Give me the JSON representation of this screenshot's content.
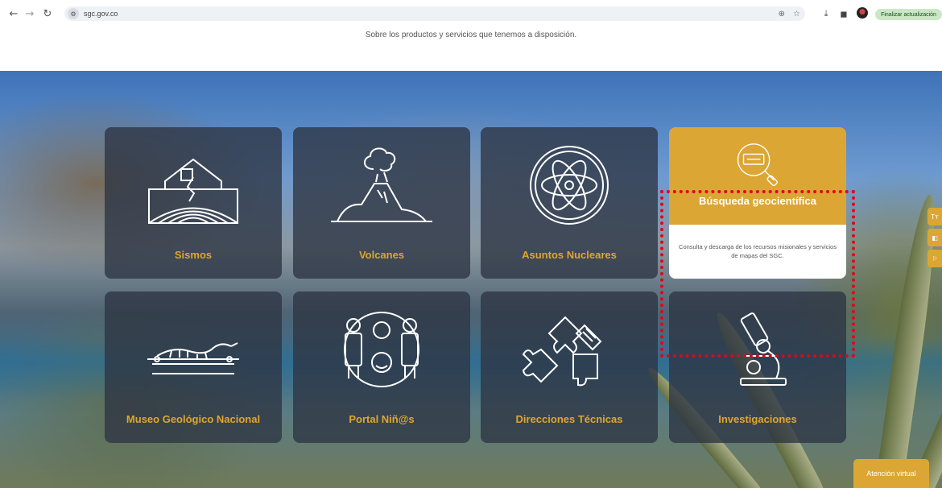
{
  "browser": {
    "back_icon": "arrow-left-icon",
    "forward_icon": "arrow-right-icon",
    "reload_icon": "reload-icon",
    "url": "sgc.gov.co",
    "update_label": "Finalizar actualización"
  },
  "page": {
    "subtitle": "Sobre los productos y servicios que tenemos a disposición."
  },
  "cards": [
    {
      "label": "Sismos",
      "icon": "earthquake-house-icon"
    },
    {
      "label": "Volcanes",
      "icon": "volcano-icon"
    },
    {
      "label": "Asuntos Nucleares",
      "icon": "atom-icon"
    },
    {
      "label": "Búsqueda geocientífica",
      "icon": "magnifier-icon",
      "description": "Consulta y descarga de los recursos misionales y servicios de mapas del SGC."
    },
    {
      "label": "Museo Geológico Nacional",
      "icon": "dinosaur-icon"
    },
    {
      "label": "Portal Niñ@s",
      "icon": "children-icon"
    },
    {
      "label": "Direcciones Técnicas",
      "icon": "puzzle-icon"
    },
    {
      "label": "Investigaciones",
      "icon": "microscope-icon"
    }
  ],
  "side_tabs": [
    "Tт",
    "◧",
    "⚐"
  ],
  "virtual_button": "Atención virtual",
  "colors": {
    "accent": "#dca634",
    "card_bg": "#2d3442",
    "highlight": "#e0061a"
  }
}
